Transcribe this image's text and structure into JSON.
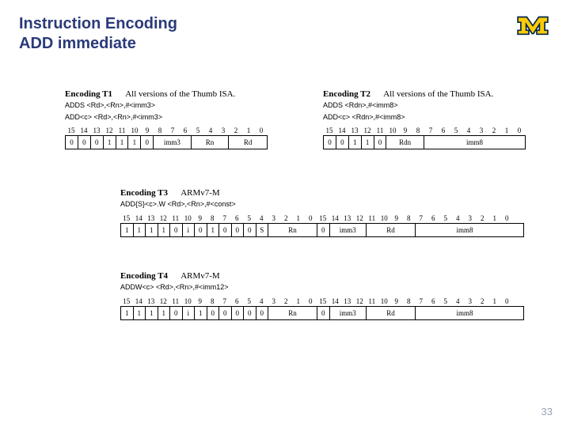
{
  "title_line1": "Instruction Encoding",
  "title_line2": "ADD immediate",
  "page_number": "33",
  "logo": {
    "alt": "Michigan M",
    "fill": "#ffcb05",
    "stroke": "#00274c"
  },
  "encodings": {
    "t1": {
      "name": "Encoding T1",
      "versions": "All versions of the Thumb ISA.",
      "asm1": "ADDS <Rd>,<Rn>,#<imm3>",
      "asm2": "ADD<c> <Rd>,<Rn>,#<imm3>",
      "bit_labels": [
        "15",
        "14",
        "13",
        "12",
        "11",
        "10",
        "9",
        "8",
        "7",
        "6",
        "5",
        "4",
        "3",
        "2",
        "1",
        "0"
      ],
      "fields": [
        {
          "w": 1,
          "text": "0"
        },
        {
          "w": 1,
          "text": "0"
        },
        {
          "w": 1,
          "text": "0"
        },
        {
          "w": 1,
          "text": "1"
        },
        {
          "w": 1,
          "text": "1"
        },
        {
          "w": 1,
          "text": "1"
        },
        {
          "w": 1,
          "text": "0"
        },
        {
          "w": 3,
          "text": "imm3"
        },
        {
          "w": 3,
          "text": "Rn"
        },
        {
          "w": 3,
          "text": "Rd"
        }
      ]
    },
    "t2": {
      "name": "Encoding T2",
      "versions": "All versions of the Thumb ISA.",
      "asm1": "ADDS <Rdn>,#<imm8>",
      "asm2": "ADD<c> <Rdn>,#<imm8>",
      "bit_labels": [
        "15",
        "14",
        "13",
        "12",
        "11",
        "10",
        "9",
        "8",
        "7",
        "6",
        "5",
        "4",
        "3",
        "2",
        "1",
        "0"
      ],
      "fields": [
        {
          "w": 1,
          "text": "0"
        },
        {
          "w": 1,
          "text": "0"
        },
        {
          "w": 1,
          "text": "1"
        },
        {
          "w": 1,
          "text": "1"
        },
        {
          "w": 1,
          "text": "0"
        },
        {
          "w": 3,
          "text": "Rdn"
        },
        {
          "w": 8,
          "text": "imm8"
        }
      ]
    },
    "t3": {
      "name": "Encoding T3",
      "versions": "ARMv7-M",
      "asm1": "ADD{S}<c>.W <Rd>,<Rn>,#<const>",
      "asm2": "",
      "bit_labels": [
        "15",
        "14",
        "13",
        "12",
        "11",
        "10",
        "9",
        "8",
        "7",
        "6",
        "5",
        "4",
        "3",
        "2",
        "1",
        "0",
        "15",
        "14",
        "13",
        "12",
        "11",
        "10",
        "9",
        "8",
        "7",
        "6",
        "5",
        "4",
        "3",
        "2",
        "1",
        "0"
      ],
      "fields": [
        {
          "w": 1,
          "text": "1"
        },
        {
          "w": 1,
          "text": "1"
        },
        {
          "w": 1,
          "text": "1"
        },
        {
          "w": 1,
          "text": "1"
        },
        {
          "w": 1,
          "text": "0"
        },
        {
          "w": 1,
          "text": "i"
        },
        {
          "w": 1,
          "text": "0"
        },
        {
          "w": 1,
          "text": "1"
        },
        {
          "w": 1,
          "text": "0"
        },
        {
          "w": 1,
          "text": "0"
        },
        {
          "w": 1,
          "text": "0"
        },
        {
          "w": 1,
          "text": "S"
        },
        {
          "w": 4,
          "text": "Rn"
        },
        {
          "w": 1,
          "text": "0"
        },
        {
          "w": 3,
          "text": "imm3"
        },
        {
          "w": 4,
          "text": "Rd"
        },
        {
          "w": 8,
          "text": "imm8"
        }
      ]
    },
    "t4": {
      "name": "Encoding T4",
      "versions": "ARMv7-M",
      "asm1": "ADDW<c> <Rd>,<Rn>,#<imm12>",
      "asm2": "",
      "bit_labels": [
        "15",
        "14",
        "13",
        "12",
        "11",
        "10",
        "9",
        "8",
        "7",
        "6",
        "5",
        "4",
        "3",
        "2",
        "1",
        "0",
        "15",
        "14",
        "13",
        "12",
        "11",
        "10",
        "9",
        "8",
        "7",
        "6",
        "5",
        "4",
        "3",
        "2",
        "1",
        "0"
      ],
      "fields": [
        {
          "w": 1,
          "text": "1"
        },
        {
          "w": 1,
          "text": "1"
        },
        {
          "w": 1,
          "text": "1"
        },
        {
          "w": 1,
          "text": "1"
        },
        {
          "w": 1,
          "text": "0"
        },
        {
          "w": 1,
          "text": "i"
        },
        {
          "w": 1,
          "text": "1"
        },
        {
          "w": 1,
          "text": "0"
        },
        {
          "w": 1,
          "text": "0"
        },
        {
          "w": 1,
          "text": "0"
        },
        {
          "w": 1,
          "text": "0"
        },
        {
          "w": 1,
          "text": "0"
        },
        {
          "w": 4,
          "text": "Rn"
        },
        {
          "w": 1,
          "text": "0"
        },
        {
          "w": 3,
          "text": "imm3"
        },
        {
          "w": 4,
          "text": "Rd"
        },
        {
          "w": 8,
          "text": "imm8"
        }
      ]
    }
  }
}
